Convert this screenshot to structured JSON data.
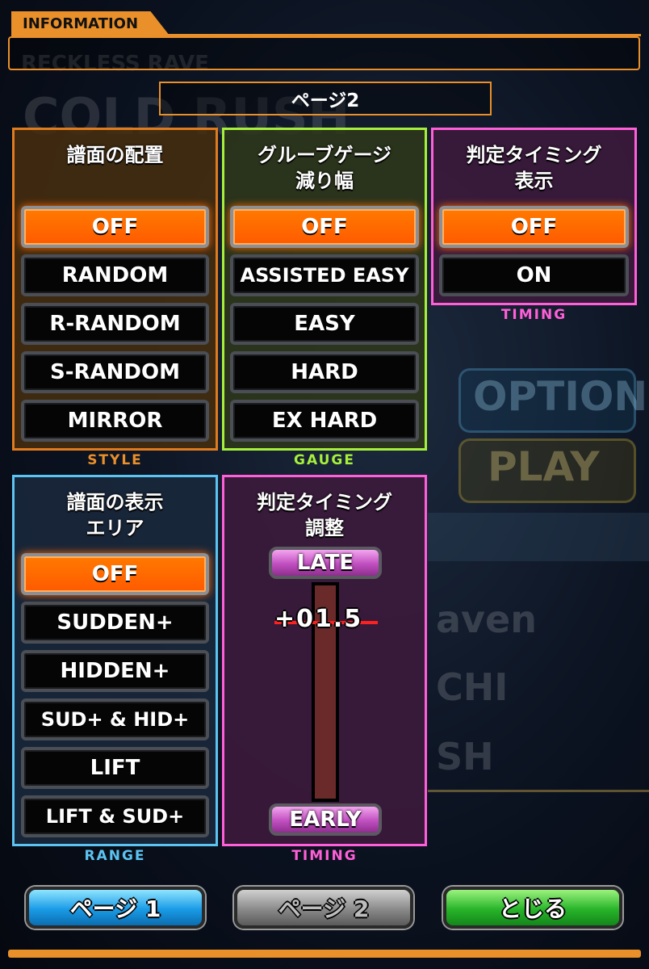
{
  "header": {
    "tab_label": "INFORMATION",
    "page_indicator": "ページ2"
  },
  "background": {
    "title_small": "RECKLESS RAVE",
    "title_large": "COLD RUSH",
    "option_button": "OPTION",
    "play_button": "PLAY",
    "list_item_1": "aven",
    "list_item_2": "CHI",
    "list_item_3": "SH"
  },
  "panels": {
    "style": {
      "title_line1": "譜面の配置",
      "caption": "STYLE",
      "options": [
        "OFF",
        "RANDOM",
        "R-RANDOM",
        "S-RANDOM",
        "MIRROR"
      ],
      "selected": "OFF"
    },
    "gauge": {
      "title_line1": "グルーブゲージ",
      "title_line2": "減り幅",
      "caption": "GAUGE",
      "options": [
        "OFF",
        "ASSISTED EASY",
        "EASY",
        "HARD",
        "EX HARD"
      ],
      "selected": "OFF"
    },
    "timing_display": {
      "title_line1": "判定タイミング",
      "title_line2": "表示",
      "caption": "TIMING",
      "options": [
        "OFF",
        "ON"
      ],
      "selected": "OFF"
    },
    "range": {
      "title_line1": "譜面の表示",
      "title_line2": "エリア",
      "caption": "RANGE",
      "options": [
        "OFF",
        "SUDDEN+",
        "HIDDEN+",
        "SUD+ & HID+",
        "LIFT",
        "LIFT & SUD+"
      ],
      "selected": "OFF"
    },
    "timing_adjust": {
      "title_line1": "判定タイミング",
      "title_line2": "調整",
      "caption": "TIMING",
      "late_label": "LATE",
      "early_label": "EARLY",
      "value": "+01.5"
    }
  },
  "footer": {
    "page1_button": "ページ 1",
    "page2_button": "ページ 2",
    "close_button": "とじる"
  },
  "colors": {
    "accent": "#e9902a",
    "selected": "#ff6a00",
    "style_border": "#e07b1e",
    "gauge_border": "#a6f03c",
    "timing_border": "#ff5fd8",
    "range_border": "#5bc4f2"
  }
}
